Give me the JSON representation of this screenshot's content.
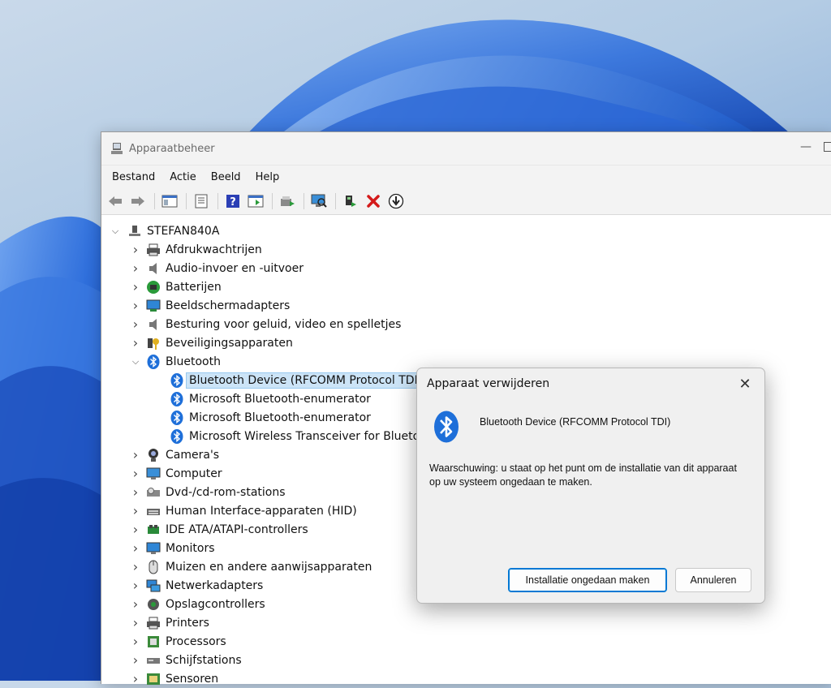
{
  "window": {
    "title": "Apparaatbeheer",
    "minimize_glyph": "—"
  },
  "menu": [
    "Bestand",
    "Actie",
    "Beeld",
    "Help"
  ],
  "toolbar_icons": [
    "back-arrow-icon",
    "forward-arrow-icon",
    "show-hide-console-tree-icon",
    "properties-sheet-icon",
    "help-icon",
    "action-pane-icon",
    "update-driver-icon",
    "scan-hardware-changes-icon",
    "enable-device-icon",
    "uninstall-device-icon",
    "download-driver-icon"
  ],
  "tree": {
    "root": "STEFAN840A",
    "categories": [
      {
        "label": "Afdrukwachtrijen",
        "icon": "printer-queue-icon"
      },
      {
        "label": "Audio-invoer en -uitvoer",
        "icon": "speaker-icon"
      },
      {
        "label": "Batterijen",
        "icon": "battery-icon"
      },
      {
        "label": "Beeldschermadapters",
        "icon": "display-adapter-icon"
      },
      {
        "label": "Besturing voor geluid, video en spelletjes",
        "icon": "speaker-icon"
      },
      {
        "label": "Beveiligingsapparaten",
        "icon": "security-key-icon"
      },
      {
        "label": "Bluetooth",
        "icon": "bluetooth-icon"
      }
    ],
    "bluetooth_children": [
      "Bluetooth Device (RFCOMM Protocol TDI)",
      "Microsoft Bluetooth-enumerator",
      "Microsoft Bluetooth-enumerator",
      "Microsoft Wireless Transceiver for Bluetooth"
    ],
    "categories_after": [
      {
        "label": "Camera's",
        "icon": "camera-icon"
      },
      {
        "label": "Computer",
        "icon": "computer-icon"
      },
      {
        "label": "Dvd-/cd-rom-stations",
        "icon": "dvd-drive-icon"
      },
      {
        "label": "Human Interface-apparaten (HID)",
        "icon": "hid-icon"
      },
      {
        "label": "IDE ATA/ATAPI-controllers",
        "icon": "ide-controller-icon"
      },
      {
        "label": "Monitors",
        "icon": "monitor-icon"
      },
      {
        "label": "Muizen en andere aanwijsapparaten",
        "icon": "mouse-icon"
      },
      {
        "label": "Netwerkadapters",
        "icon": "network-adapter-icon"
      },
      {
        "label": "Opslagcontrollers",
        "icon": "storage-controller-icon"
      },
      {
        "label": "Printers",
        "icon": "printer-icon"
      },
      {
        "label": "Processors",
        "icon": "processor-icon"
      },
      {
        "label": "Schijfstations",
        "icon": "disk-drive-icon"
      },
      {
        "label": "Sensoren",
        "icon": "sensor-icon"
      }
    ]
  },
  "dialog": {
    "title": "Apparaat verwijderen",
    "device_name": "Bluetooth Device (RFCOMM Protocol TDI)",
    "warning": "Waarschuwing: u staat op het punt om de installatie van dit apparaat op uw systeem ongedaan te maken.",
    "confirm_button": "Installatie ongedaan maken",
    "cancel_button": "Annuleren"
  },
  "colors": {
    "accent": "#0078d4",
    "bluetooth_blue": "#1e6fd9",
    "selection": "#cce4f7",
    "uninstall_red": "#d41a1a"
  }
}
